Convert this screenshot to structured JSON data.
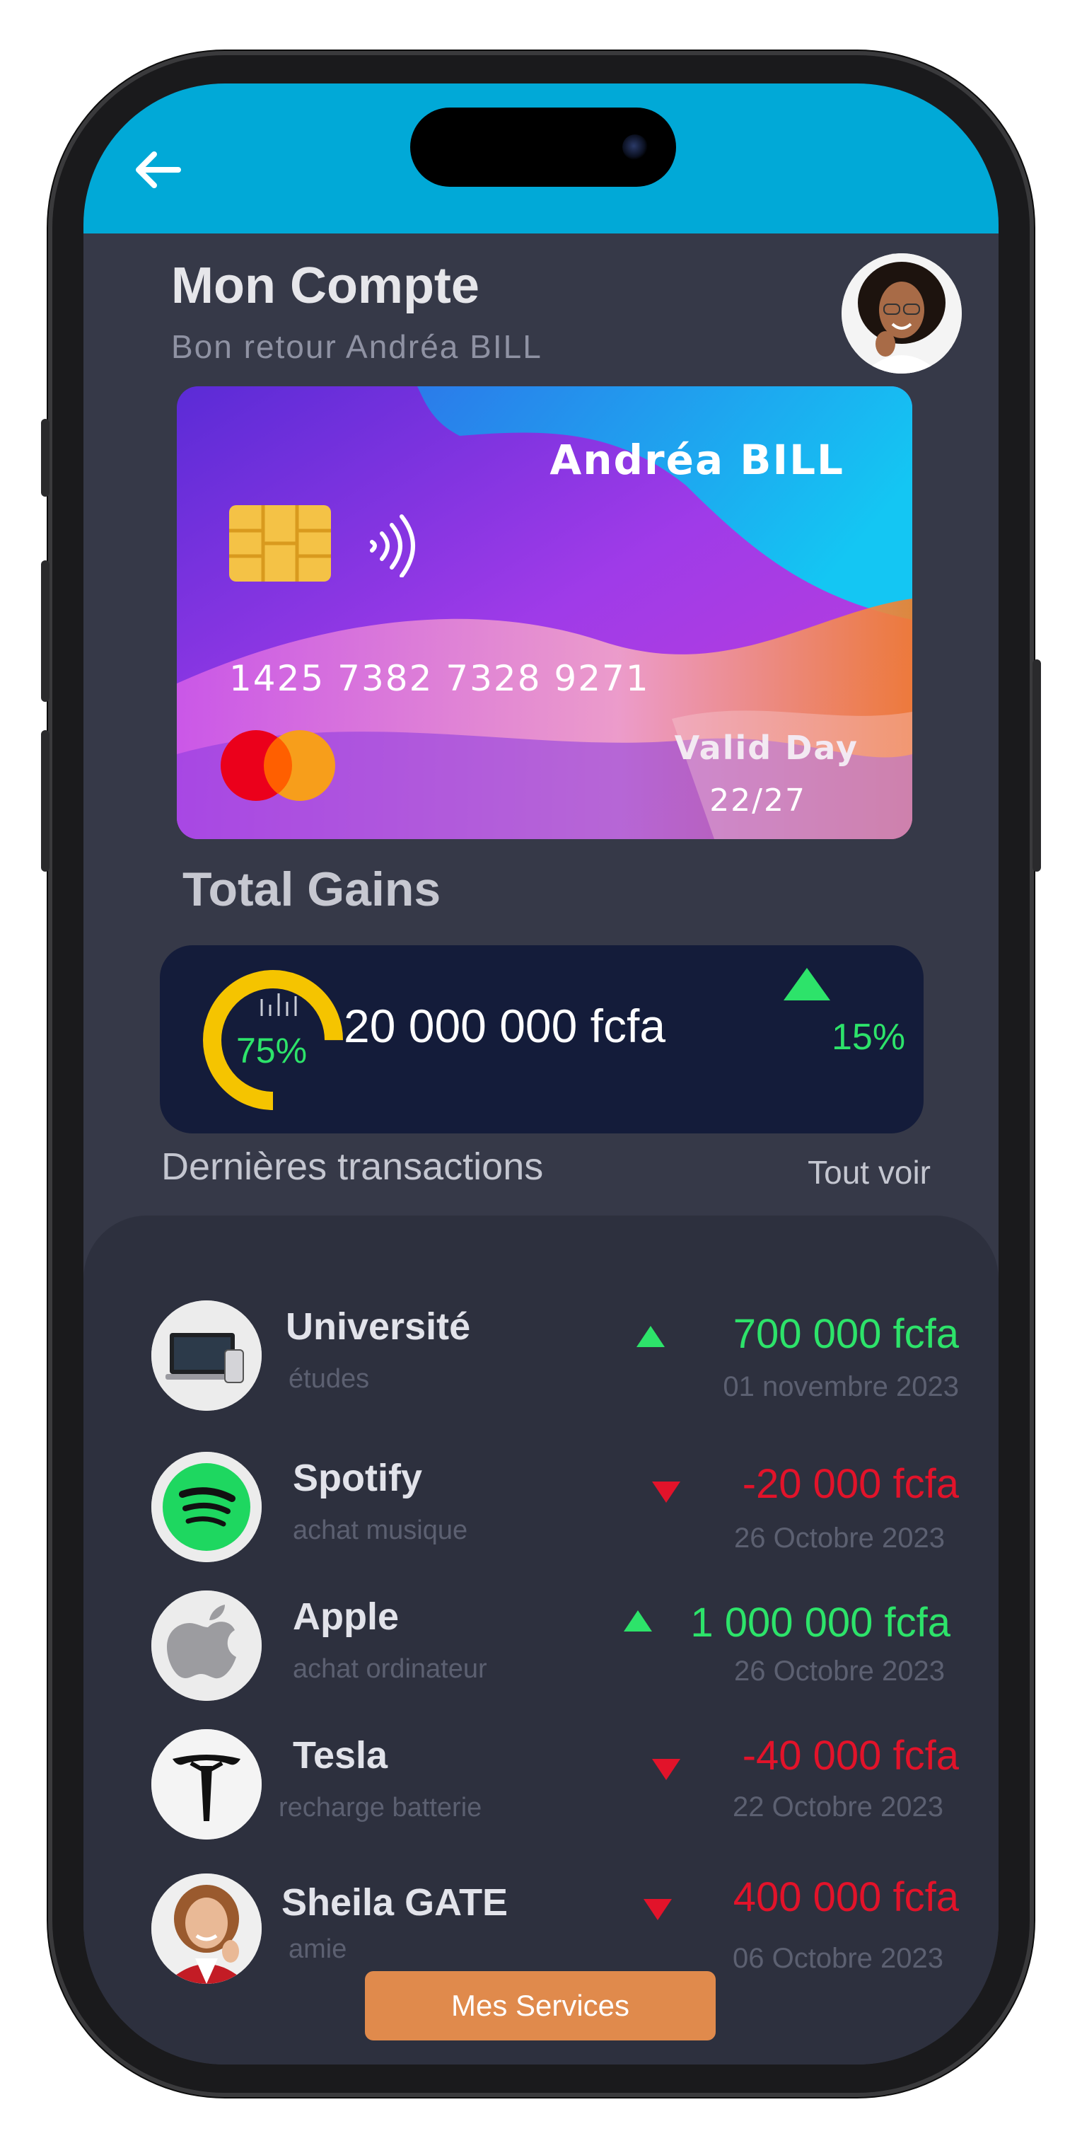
{
  "header": {
    "title": "Mon Compte",
    "subtitle": "Bon retour Andréa BILL"
  },
  "card": {
    "holder": "Andréa BILL",
    "number": "1425 7382 7328 9271",
    "valid_label": "Valid Day",
    "valid_date": "22/27",
    "network": "mastercard-logo"
  },
  "gains": {
    "title": "Total Gains",
    "progress_pct": 75,
    "progress_label": "75%",
    "amount": "20 000 000 fcfa",
    "change": "15%",
    "change_direction": "up"
  },
  "transactions": {
    "header": "Dernières transactions",
    "see_all": "Tout voir",
    "items": [
      {
        "name": "Université",
        "category": "études",
        "amount": "700 000 fcfa",
        "direction": "up",
        "date": "01 novembre 2023",
        "icon": "laptop-phone-icon"
      },
      {
        "name": "Spotify",
        "category": "achat musique",
        "amount": "-20 000 fcfa",
        "direction": "down",
        "date": "26 Octobre 2023",
        "icon": "spotify-icon"
      },
      {
        "name": "Apple",
        "category": "achat ordinateur",
        "amount": "1 000 000 fcfa",
        "direction": "up",
        "date": "26 Octobre 2023",
        "icon": "apple-icon"
      },
      {
        "name": "Tesla",
        "category": "recharge batterie",
        "amount": "-40 000 fcfa",
        "direction": "down",
        "date": "22 Octobre 2023",
        "icon": "tesla-icon"
      },
      {
        "name": "Sheila GATE",
        "category": "amie",
        "amount": "400 000 fcfa",
        "direction": "down",
        "date": "06 Octobre 2023",
        "icon": "contact-avatar"
      }
    ]
  },
  "actions": {
    "services_label": "Mes Services"
  },
  "colors": {
    "topbar": "#01a9d7",
    "background": "#363948",
    "positive": "#2de36a",
    "negative": "#e2132a",
    "button": "#e08a4c"
  }
}
